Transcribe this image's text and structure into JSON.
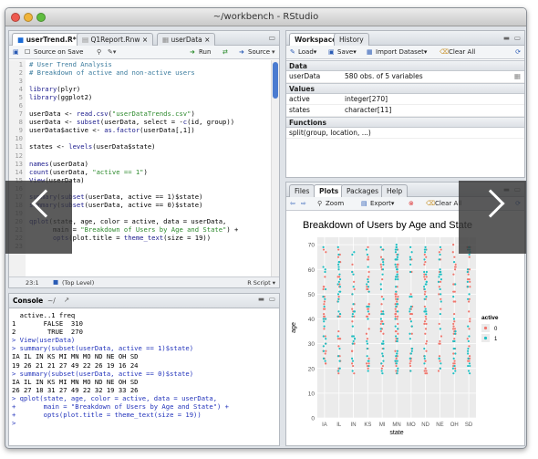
{
  "window": {
    "title": "~/workbench - RStudio"
  },
  "editor": {
    "tabs": [
      "userTrend.R*",
      "Q1Report.Rnw",
      "userData"
    ],
    "toolbar": {
      "source_on_save": "Source on Save",
      "run": "Run",
      "source": "Source"
    },
    "lines": [
      {
        "n": "1",
        "t": [
          [
            "c-com",
            "# User Trend Analysis"
          ]
        ]
      },
      {
        "n": "2",
        "t": [
          [
            "c-com",
            "# Breakdown of active and non-active users"
          ]
        ]
      },
      {
        "n": "3",
        "t": []
      },
      {
        "n": "4",
        "t": [
          [
            "c-fn",
            "library"
          ],
          [
            "",
            "(plyr)"
          ]
        ]
      },
      {
        "n": "5",
        "t": [
          [
            "c-fn",
            "library"
          ],
          [
            "",
            "(ggplot2)"
          ]
        ]
      },
      {
        "n": "6",
        "t": []
      },
      {
        "n": "7",
        "t": [
          [
            "",
            "userData <- "
          ],
          [
            "c-fn",
            "read.csv"
          ],
          [
            "",
            "("
          ],
          [
            "c-str",
            "\"userDataTrends.csv\""
          ],
          [
            "",
            ")"
          ]
        ]
      },
      {
        "n": "8",
        "t": [
          [
            "",
            "userData <- "
          ],
          [
            "c-fn",
            "subset"
          ],
          [
            "",
            "(userData, select = -"
          ],
          [
            "c-fn",
            "c"
          ],
          [
            "",
            "(id, group))"
          ]
        ]
      },
      {
        "n": "9",
        "t": [
          [
            "",
            "userData$active <- "
          ],
          [
            "c-fn",
            "as.factor"
          ],
          [
            "",
            "(userData[,1])"
          ]
        ]
      },
      {
        "n": "10",
        "t": []
      },
      {
        "n": "11",
        "t": [
          [
            "",
            "states <- "
          ],
          [
            "c-fn",
            "levels"
          ],
          [
            "",
            "(userData$state)"
          ]
        ]
      },
      {
        "n": "12",
        "t": []
      },
      {
        "n": "13",
        "t": [
          [
            "c-fn",
            "names"
          ],
          [
            "",
            "(userData)"
          ]
        ]
      },
      {
        "n": "14",
        "t": [
          [
            "c-fn",
            "count"
          ],
          [
            "",
            "(userData, "
          ],
          [
            "c-str",
            "\"active == 1\""
          ],
          [
            "",
            ")"
          ]
        ]
      },
      {
        "n": "15",
        "t": [
          [
            "c-fn",
            "View"
          ],
          [
            "",
            "(userData)"
          ]
        ]
      },
      {
        "n": "16",
        "t": []
      },
      {
        "n": "17",
        "t": [
          [
            "c-fn",
            "summary"
          ],
          [
            "",
            "("
          ],
          [
            "c-fn",
            "subset"
          ],
          [
            "",
            "(userData, active == 1)$state)"
          ]
        ]
      },
      {
        "n": "18",
        "t": [
          [
            "c-fn",
            "summary"
          ],
          [
            "",
            "("
          ],
          [
            "c-fn",
            "subset"
          ],
          [
            "",
            "(userData, active == 0)$state)"
          ]
        ]
      },
      {
        "n": "19",
        "t": []
      },
      {
        "n": "20",
        "t": [
          [
            "c-fn",
            "qplot"
          ],
          [
            "",
            "(state, age, color = active, data = userData,"
          ]
        ]
      },
      {
        "n": "21",
        "t": [
          [
            "",
            "      main = "
          ],
          [
            "c-str",
            "\"Breakdown of Users by Age and State\""
          ],
          [
            "",
            ") +"
          ]
        ]
      },
      {
        "n": "22",
        "t": [
          [
            "",
            "      "
          ],
          [
            "c-fn",
            "opts"
          ],
          [
            "",
            "(plot.title = "
          ],
          [
            "c-fn",
            "theme_text"
          ],
          [
            "",
            "(size = 19))"
          ]
        ]
      },
      {
        "n": "23",
        "t": []
      }
    ],
    "status": {
      "position": "23:1",
      "scope": "(Top Level)",
      "filetype": "R Script"
    }
  },
  "console": {
    "title": "Console",
    "path": "~/",
    "lines": [
      {
        "c": "",
        "t": "  active..1 freq"
      },
      {
        "c": "",
        "t": "1       FALSE  310"
      },
      {
        "c": "",
        "t": "2        TRUE  270"
      },
      {
        "c": "c-blue",
        "t": "> View(userData)"
      },
      {
        "c": "c-blue",
        "t": "> summary(subset(userData, active == 1)$state)"
      },
      {
        "c": "",
        "t": "IA IL IN KS MI MN MO ND NE OH SD"
      },
      {
        "c": "",
        "t": "19 26 21 21 27 49 22 26 19 16 24"
      },
      {
        "c": "c-blue",
        "t": "> summary(subset(userData, active == 0)$state)"
      },
      {
        "c": "",
        "t": "IA IL IN KS MI MN MO ND NE OH SD"
      },
      {
        "c": "",
        "t": "26 27 18 31 27 49 22 32 19 33 26"
      },
      {
        "c": "c-blue",
        "t": "> qplot(state, age, color = active, data = userData,"
      },
      {
        "c": "c-blue",
        "t": "+       main = \"Breakdown of Users by Age and State\") +"
      },
      {
        "c": "c-blue",
        "t": "+       opts(plot.title = theme_text(size = 19))"
      },
      {
        "c": "c-blue",
        "t": ">"
      }
    ]
  },
  "workspace": {
    "tabs": [
      "Workspace",
      "History"
    ],
    "toolbar": {
      "load": "Load",
      "save": "Save",
      "import": "Import Dataset",
      "clear": "Clear All"
    },
    "data_header": "Data",
    "data": [
      {
        "name": "userData",
        "value": "580 obs. of 5 variables"
      }
    ],
    "values_header": "Values",
    "values": [
      {
        "name": "active",
        "value": "integer[270]"
      },
      {
        "name": "states",
        "value": "character[11]"
      }
    ],
    "functions_header": "Functions",
    "functions": [
      {
        "name": "split(group, location, ...)"
      }
    ]
  },
  "plots_pane": {
    "tabs": [
      "Files",
      "Plots",
      "Packages",
      "Help"
    ],
    "toolbar": {
      "zoom": "Zoom",
      "export": "Export",
      "clear": "Clear All"
    }
  },
  "chart_data": {
    "type": "scatter",
    "title": "Breakdown of Users by Age and State",
    "xlabel": "state",
    "ylabel": "age",
    "categories": [
      "IA",
      "IL",
      "IN",
      "KS",
      "MI",
      "MN",
      "MO",
      "ND",
      "NE",
      "OH",
      "SD"
    ],
    "yticks": [
      0,
      10,
      20,
      30,
      40,
      50,
      60,
      70
    ],
    "ylim": [
      0,
      73
    ],
    "grid": true,
    "legend": {
      "title": "active",
      "entries": [
        "0",
        "1"
      ],
      "placement": "right"
    },
    "series": [
      {
        "name": "0",
        "color": "#f0766d",
        "counts": [
          26,
          27,
          18,
          31,
          27,
          49,
          22,
          32,
          19,
          33,
          26
        ]
      },
      {
        "name": "1",
        "color": "#1fbfc3",
        "counts": [
          19,
          26,
          21,
          21,
          27,
          49,
          22,
          26,
          19,
          16,
          24
        ]
      }
    ]
  }
}
